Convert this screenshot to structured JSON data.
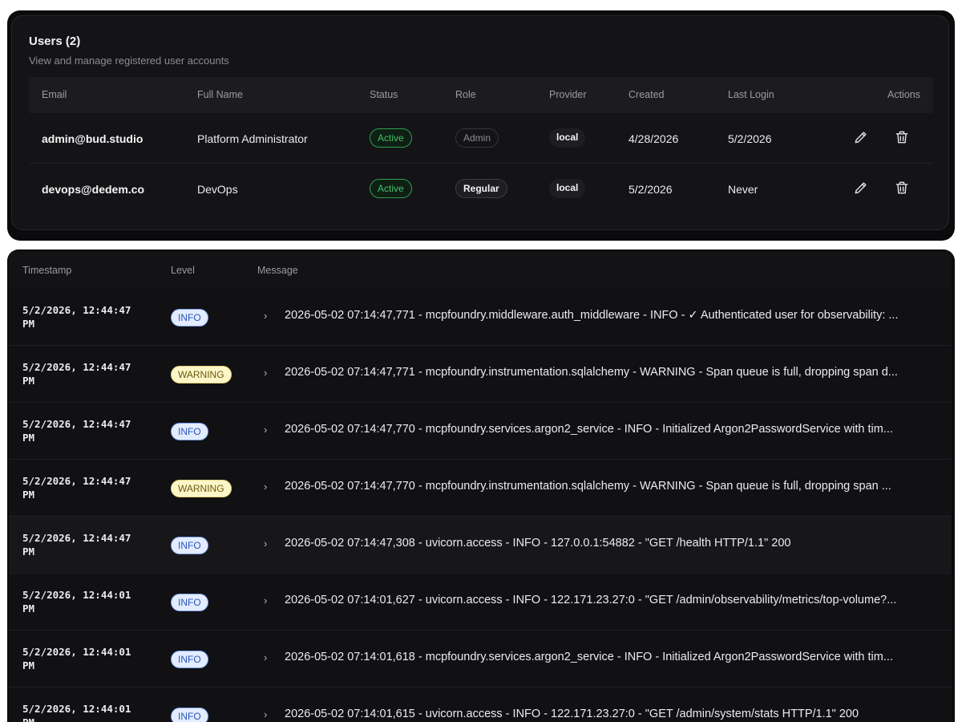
{
  "users": {
    "title": "Users (2)",
    "subtitle": "View and manage registered user accounts",
    "columns": {
      "email": "Email",
      "full_name": "Full Name",
      "status": "Status",
      "role": "Role",
      "provider": "Provider",
      "created": "Created",
      "last_login": "Last Login",
      "actions": "Actions"
    },
    "rows": [
      {
        "email": "admin@bud.studio",
        "full_name": "Platform Administrator",
        "status": "Active",
        "role": "Admin",
        "provider": "local",
        "created": "4/28/2026",
        "last_login": "5/2/2026"
      },
      {
        "email": "devops@dedem.co",
        "full_name": "DevOps",
        "status": "Active",
        "role": "Regular",
        "provider": "local",
        "created": "5/2/2026",
        "last_login": "Never"
      }
    ],
    "icons": {
      "edit": "pencil-icon",
      "delete": "trash-icon"
    }
  },
  "logs": {
    "columns": {
      "timestamp": "Timestamp",
      "level": "Level",
      "message": "Message"
    },
    "expand_icon": "›",
    "rows": [
      {
        "ts_line1": "5/2/2026, 12:44:47",
        "ts_line2": "PM",
        "level": "INFO",
        "message": "2026-05-02 07:14:47,771 - mcpfoundry.middleware.auth_middleware - INFO - ✓ Authenticated user for observability: ..."
      },
      {
        "ts_line1": "5/2/2026, 12:44:47",
        "ts_line2": "PM",
        "level": "WARNING",
        "message": "2026-05-02 07:14:47,771 - mcpfoundry.instrumentation.sqlalchemy - WARNING - Span queue is full, dropping span d..."
      },
      {
        "ts_line1": "5/2/2026, 12:44:47",
        "ts_line2": "PM",
        "level": "INFO",
        "message": "2026-05-02 07:14:47,770 - mcpfoundry.services.argon2_service - INFO - Initialized Argon2PasswordService with tim..."
      },
      {
        "ts_line1": "5/2/2026, 12:44:47",
        "ts_line2": "PM",
        "level": "WARNING",
        "message": "2026-05-02 07:14:47,770 - mcpfoundry.instrumentation.sqlalchemy - WARNING - Span queue is full, dropping span ..."
      },
      {
        "ts_line1": "5/2/2026, 12:44:47",
        "ts_line2": "PM",
        "level": "INFO",
        "message": "2026-05-02 07:14:47,308 - uvicorn.access - INFO - 127.0.0.1:54882 - \"GET /health HTTP/1.1\" 200"
      },
      {
        "ts_line1": "5/2/2026, 12:44:01",
        "ts_line2": "PM",
        "level": "INFO",
        "message": "2026-05-02 07:14:01,627 - uvicorn.access - INFO - 122.171.23.27:0 - \"GET /admin/observability/metrics/top-volume?..."
      },
      {
        "ts_line1": "5/2/2026, 12:44:01",
        "ts_line2": "PM",
        "level": "INFO",
        "message": "2026-05-02 07:14:01,618 - mcpfoundry.services.argon2_service - INFO - Initialized Argon2PasswordService with tim..."
      },
      {
        "ts_line1": "5/2/2026, 12:44:01",
        "ts_line2": "PM",
        "level": "INFO",
        "message": "2026-05-02 07:14:01,615 - uvicorn.access - INFO - 122.171.23.27:0 - \"GET /admin/system/stats HTTP/1.1\" 200"
      }
    ]
  },
  "colors": {
    "active_green": "#43c068",
    "info_blue": "#2c56b8",
    "warning_yellow": "#fdf6c9"
  }
}
